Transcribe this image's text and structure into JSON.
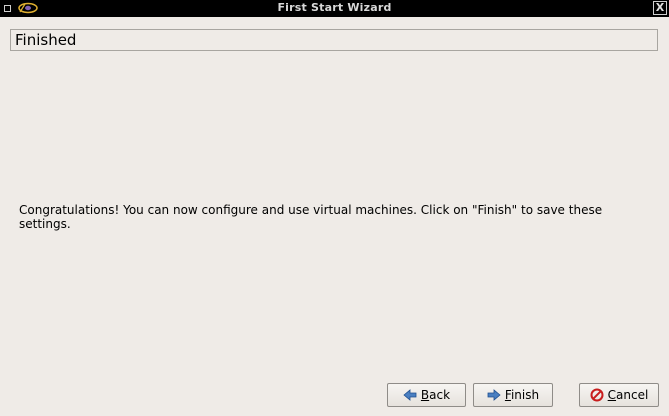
{
  "window": {
    "title": "First Start Wizard",
    "close_glyph": "X"
  },
  "page": {
    "heading": "Finished",
    "message": "Congratulations! You can now configure and use virtual machines. Click on \"Finish\" to save these settings."
  },
  "buttons": {
    "back": {
      "mnemonic": "B",
      "rest": "ack",
      "icon": "arrow-left-icon"
    },
    "finish": {
      "mnemonic": "F",
      "rest": "inish",
      "icon": "arrow-right-icon"
    },
    "cancel": {
      "mnemonic": "C",
      "rest": "ancel",
      "icon": "cancel-icon"
    }
  },
  "colors": {
    "window_bg": "#efebe7",
    "titlebar_bg": "#000000",
    "arrow_blue": "#4a7fc1",
    "cancel_red": "#c81e1e"
  }
}
